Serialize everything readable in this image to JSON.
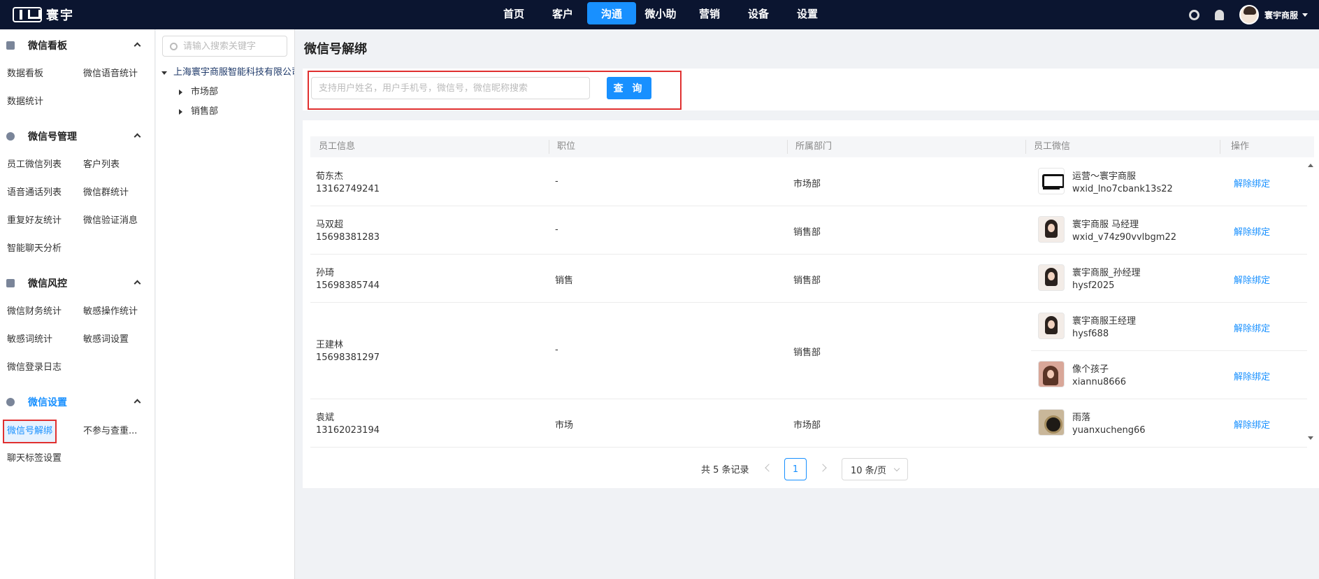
{
  "brand": {
    "name": "寰宇"
  },
  "nav": [
    "首页",
    "客户",
    "沟通",
    "微小助",
    "营销",
    "设备",
    "设置"
  ],
  "nav_active": "沟通",
  "user": {
    "name": "寰宇商服"
  },
  "sidebar": {
    "groups": [
      {
        "title": "微信看板",
        "icon": "chart-icon",
        "items": [
          "数据看板",
          "微信语音统计",
          "数据统计"
        ]
      },
      {
        "title": "微信号管理",
        "icon": "wechat-icon",
        "items": [
          "员工微信列表",
          "客户列表",
          "语音通话列表",
          "微信群统计",
          "重复好友统计",
          "微信验证消息",
          "智能聊天分析"
        ]
      },
      {
        "title": "微信风控",
        "icon": "shield-icon",
        "items": [
          "微信财务统计",
          "敏感操作统计",
          "敏感词统计",
          "敏感词设置",
          "微信登录日志"
        ]
      },
      {
        "title": "微信设置",
        "icon": "gear-icon",
        "items": [
          "微信号解绑",
          "不参与查重...",
          "聊天标签设置"
        ]
      }
    ],
    "active_item": "微信号解绑"
  },
  "tree": {
    "search_placeholder": "请输入搜索关键字",
    "root": "上海寰宇商服智能科技有限公司",
    "children": [
      "市场部",
      "销售部"
    ]
  },
  "page_title": "微信号解绑",
  "search": {
    "placeholder": "支持用户姓名，用户手机号，微信号，微信昵称搜索",
    "button": "查 询"
  },
  "table": {
    "columns": [
      "员工信息",
      "职位",
      "所属部门",
      "员工微信",
      "操作"
    ],
    "rows": [
      {
        "name": "荀东杰",
        "phone": "13162749241",
        "position": "-",
        "dept": "市场部",
        "wechats": [
          {
            "nick": "运营～寰宇商服",
            "id": "wxid_lno7cbank13s22",
            "avatar": "logo"
          }
        ]
      },
      {
        "name": "马双超",
        "phone": "15698381283",
        "position": "-",
        "dept": "销售部",
        "wechats": [
          {
            "nick": "寰宇商服 马经理",
            "id": "wxid_v74z90vvlbgm22",
            "avatar": "woman"
          }
        ]
      },
      {
        "name": "孙琦",
        "phone": "15698385744",
        "position": "销售",
        "dept": "销售部",
        "wechats": [
          {
            "nick": "寰宇商服_孙经理",
            "id": "hysf2025",
            "avatar": "woman"
          }
        ]
      },
      {
        "name": "王建林",
        "phone": "15698381297",
        "position": "-",
        "dept": "销售部",
        "wechats": [
          {
            "nick": "寰宇商服王经理",
            "id": "hysf688",
            "avatar": "woman"
          },
          {
            "nick": "像个孩子",
            "id": "xiannu8666",
            "avatar": "girl"
          }
        ]
      },
      {
        "name": "袁斌",
        "phone": "13162023194",
        "position": "市场",
        "dept": "市场部",
        "wechats": [
          {
            "nick": "雨落",
            "id": "yuanxucheng66",
            "avatar": "watch"
          }
        ]
      }
    ],
    "action": "解除绑定"
  },
  "pagination": {
    "total": "共 5 条记录",
    "current": "1",
    "page_size": "10 条/页"
  },
  "colors": {
    "topbar": "#0b1530",
    "accent": "#1890ff",
    "highlight": "#e03030"
  }
}
